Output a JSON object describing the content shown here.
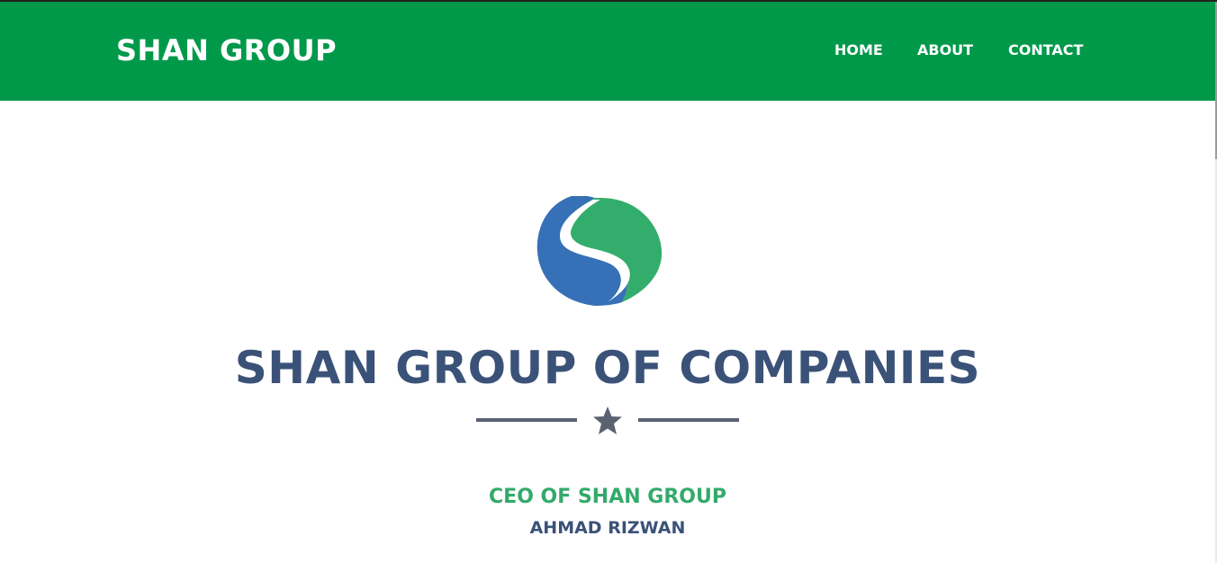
{
  "navbar": {
    "brand": "SHAN GROUP",
    "links": [
      {
        "label": "HOME"
      },
      {
        "label": "ABOUT"
      },
      {
        "label": "CONTACT"
      }
    ]
  },
  "hero": {
    "logo_icon": "shan-s-logo-icon",
    "title": "SHAN GROUP OF COMPANIES",
    "divider_icon": "star-icon",
    "subtitle": "CEO OF SHAN GROUP",
    "name": "AHMAD RIZWAN"
  },
  "colors": {
    "navbar_bg": "#00994a",
    "title": "#3b5278",
    "subtitle": "#33aa6b",
    "logo_blue": "#3670b6",
    "logo_green": "#33ad6b"
  }
}
